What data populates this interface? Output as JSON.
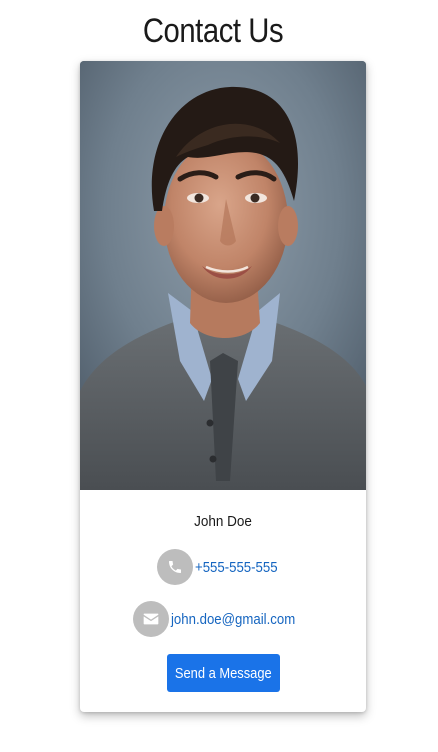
{
  "page": {
    "title": "Contact Us"
  },
  "contact_card": {
    "photo_alt": "John Doe",
    "name": "John Doe",
    "phone": {
      "icon": "phone-icon",
      "value": "+555-555-555"
    },
    "email": {
      "icon": "envelope-icon",
      "value": "john.doe@gmail.com"
    },
    "send_button_label": "Send a Message"
  },
  "colors": {
    "link": "#1565c0",
    "button": "#1a73e8",
    "icon_circle": "#bdbdbd"
  }
}
